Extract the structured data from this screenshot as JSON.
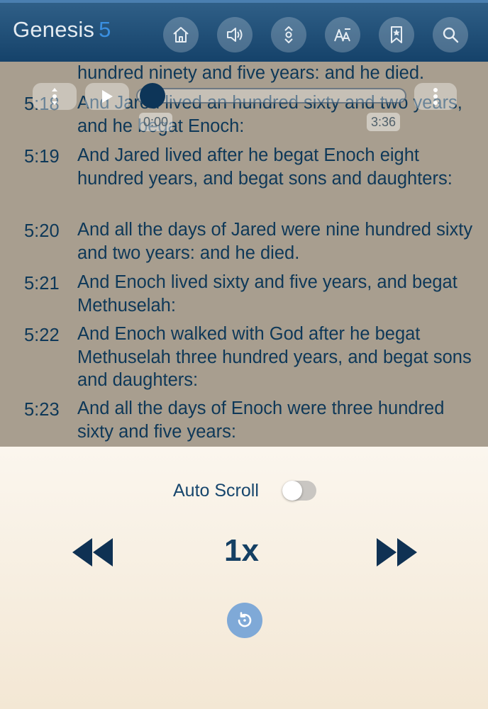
{
  "header": {
    "book": "Genesis",
    "chapter": "5",
    "buttons": [
      "home-icon",
      "speaker-icon",
      "scroll-arrows-icon",
      "font-size-icon",
      "bookmark-icon",
      "search-icon"
    ]
  },
  "verses": [
    {
      "num": "",
      "text": "hundred ninety and five years: and he died."
    },
    {
      "num": "5:18",
      "text": "And Jared lived an hundred sixty and two years, and he begat Enoch:"
    },
    {
      "num": "5:19",
      "text": "And Jared lived after he begat Enoch eight hundred years, and begat sons and daughters:"
    },
    {
      "num": "5:20",
      "text": "And all the days of Jared were nine hundred sixty and two years: and he died."
    },
    {
      "num": "5:21",
      "text": "And Enoch lived sixty and five years, and begat Methuselah:"
    },
    {
      "num": "5:22",
      "text": "And Enoch walked with God after he begat Methuselah three hundred years, and begat sons and daughters:"
    },
    {
      "num": "5:23",
      "text": "And all the days of Enoch were three hundred sixty and five years:"
    }
  ],
  "player": {
    "current_time": "0:00",
    "total_time": "3:36",
    "progress": 0
  },
  "controls": {
    "auto_scroll_label": "Auto Scroll",
    "auto_scroll_on": false,
    "speed": "1x"
  },
  "colors": {
    "header": "#1a466f",
    "text": "#0e3858",
    "accent": "#3a8fe0",
    "reset_button": "#7fa9d7"
  }
}
